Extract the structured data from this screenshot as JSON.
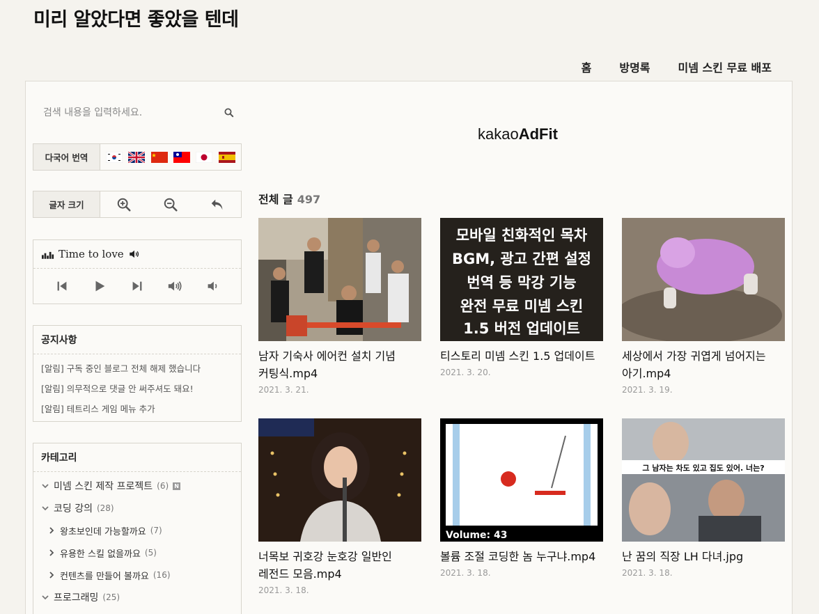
{
  "blog": {
    "title": "미리 알았다면 좋았을 텐데"
  },
  "nav": {
    "items": [
      "홈",
      "방명록",
      "미넴 스킨 무료 배포"
    ]
  },
  "search": {
    "placeholder": "검색 내용을 입력하세요."
  },
  "translate": {
    "label": "다국어 번역",
    "flags": [
      "korea-flag",
      "uk-flag",
      "china-flag",
      "taiwan-flag",
      "japan-flag",
      "spain-flag"
    ]
  },
  "font_size": {
    "label": "글자 크기"
  },
  "player": {
    "title": "Time to love"
  },
  "notice": {
    "title": "공지사항",
    "items": [
      "[알림] 구독 중인 블로그 전체 해제 했습니다",
      "[알림] 의무적으로 댓글 안 써주셔도 돼요!",
      "[알림] 테트리스 게임 메뉴 추가"
    ]
  },
  "category": {
    "title": "카테고리",
    "items": [
      {
        "label": "미넴 스킨 제작 프로젝트",
        "count": "(6)",
        "badge": "N"
      },
      {
        "label": "코딩 강의",
        "count": "(28)"
      },
      {
        "label": "왕초보인데 가능할까요",
        "count": "(7)"
      },
      {
        "label": "유용한 스킬 없을까요",
        "count": "(5)"
      },
      {
        "label": "컨텐츠를 만들어 볼까요",
        "count": "(16)"
      },
      {
        "label": "프로그래밍",
        "count": "(25)"
      }
    ]
  },
  "ad": {
    "brand_light": "kakao",
    "brand_bold": "AdFit"
  },
  "posts": {
    "header": "전체 글",
    "total": "497",
    "items": [
      {
        "title": "남자 기숙사 에어컨 설치 기념 커팅식.mp4",
        "date": "2021. 3. 21."
      },
      {
        "title": "티스토리 미넴 스킨 1.5 업데이트",
        "date": "2021. 3. 20."
      },
      {
        "title": "세상에서 가장 귀엽게 넘어지는 아기.mp4",
        "date": "2021. 3. 19."
      },
      {
        "title": "너목보 귀호강 눈호강 일반인 레전드 모음.mp4",
        "date": "2021. 3. 18."
      },
      {
        "title": "볼륨 조절 코딩한 놈 누구냐.mp4",
        "date": "2021. 3. 18."
      },
      {
        "title": "난 꿈의 직장 LH 다녀.jpg",
        "date": "2021. 3. 18."
      }
    ],
    "thumb_text": {
      "skin_lines": [
        "모바일 친화적인 목차",
        "BGM, 광고 간편 설정",
        "번역 등 막강 기능",
        "완전 무료 미넴 스킨",
        "1.5 버전 업데이트"
      ],
      "volume": "Volume: 43",
      "lh_caption": "그 남자는 차도 있고 집도 있어. 너는?"
    }
  }
}
